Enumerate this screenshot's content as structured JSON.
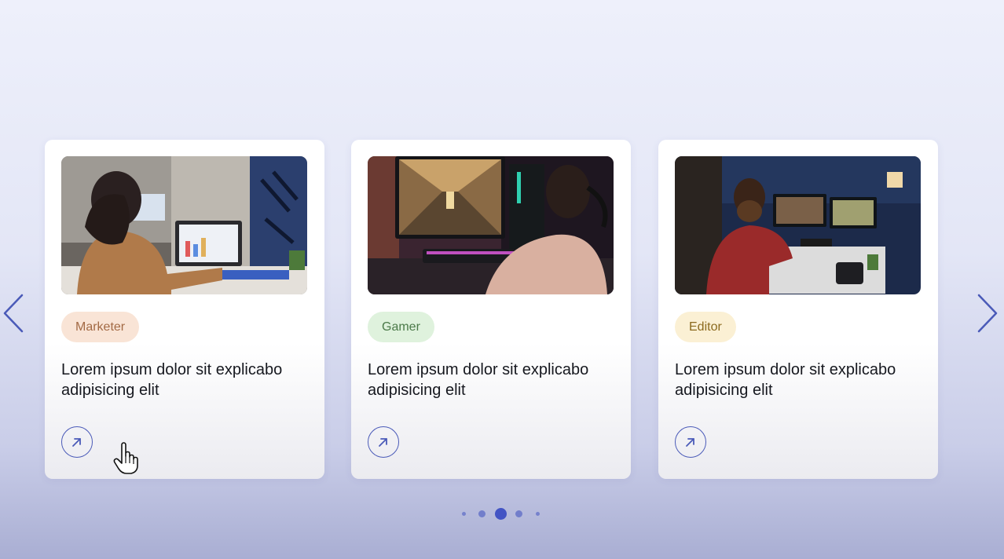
{
  "carousel": {
    "prev_icon": "chevron-left-icon",
    "next_icon": "chevron-right-icon",
    "accent_color": "#4a5ab8",
    "active_page": 3,
    "page_count": 5,
    "cards": [
      {
        "image": "woman-at-laptop-office-photo",
        "tag": "Marketer",
        "tag_color": "#f9e4d6",
        "title": "Lorem ipsum dolor sit explicabo adipisicing elit",
        "link_icon": "arrow-up-right-icon"
      },
      {
        "image": "gamer-at-monitor-photo",
        "tag": "Gamer",
        "tag_color": "#dff2dd",
        "title": "Lorem ipsum dolor sit explicabo adipisicing elit",
        "link_icon": "arrow-up-right-icon"
      },
      {
        "image": "editor-at-workstation-photo",
        "tag": "Editor",
        "tag_color": "#fbf0d4",
        "title": "Lorem ipsum dolor sit explicabo adipisicing elit",
        "link_icon": "arrow-up-right-icon"
      }
    ]
  }
}
